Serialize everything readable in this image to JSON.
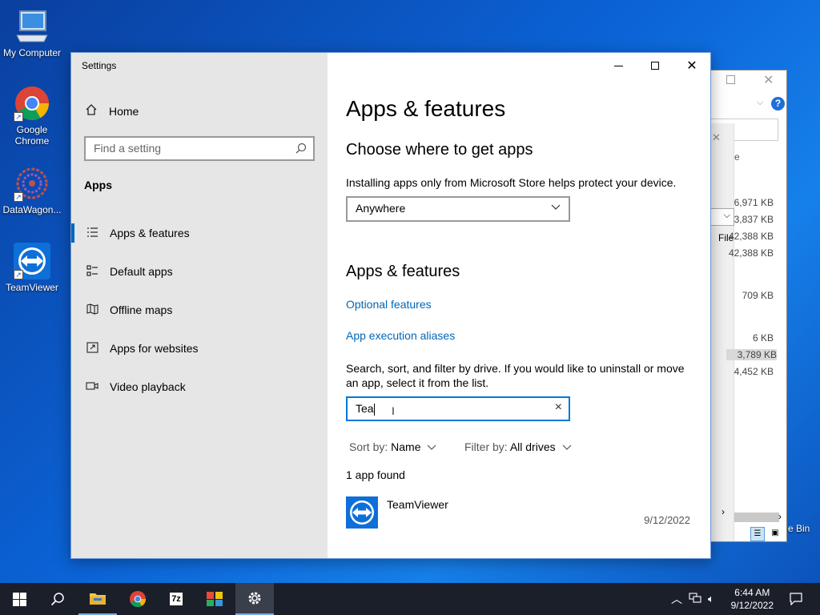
{
  "desktop": {
    "icons": [
      {
        "label": "My Computer",
        "icon": "computer-icon"
      },
      {
        "label": "Google Chrome",
        "icon": "chrome-icon"
      },
      {
        "label": "DataWagon...",
        "icon": "datawagon-icon"
      },
      {
        "label": "TeamViewer",
        "icon": "teamviewer-icon"
      }
    ]
  },
  "background_window": {
    "help_label": "?",
    "partial_text_1": "e",
    "partial_text_2": "File",
    "sizes": [
      "6,971 KB",
      "3,837 KB",
      "42,388 KB",
      "42,388 KB",
      "709 KB",
      "6 KB",
      "3,789 KB",
      "4,452 KB"
    ],
    "recycle_bin": "e Bin"
  },
  "settings": {
    "title": "Settings",
    "sidebar": {
      "home_label": "Home",
      "search_placeholder": "Find a setting",
      "section_label": "Apps",
      "items": [
        {
          "label": "Apps & features",
          "icon": "list-icon",
          "active": true
        },
        {
          "label": "Default apps",
          "icon": "default-apps-icon"
        },
        {
          "label": "Offline maps",
          "icon": "map-icon"
        },
        {
          "label": "Apps for websites",
          "icon": "web-link-icon"
        },
        {
          "label": "Video playback",
          "icon": "video-icon"
        }
      ]
    },
    "main": {
      "page_title": "Apps & features",
      "choose_heading": "Choose where to get apps",
      "choose_desc": "Installing apps only from Microsoft Store helps protect your device.",
      "source_selected": "Anywhere",
      "features_heading": "Apps & features",
      "optional_features_link": "Optional features",
      "aliases_link": "App execution aliases",
      "search_desc": "Search, sort, and filter by drive. If you would like to uninstall or move an app, select it from the list.",
      "search_value": "Tea",
      "sort_label": "Sort by:",
      "sort_value": "Name",
      "filter_label": "Filter by:",
      "filter_value": "All drives",
      "result_count": "1 app found",
      "apps": [
        {
          "name": "TeamViewer",
          "date": "9/12/2022"
        }
      ]
    }
  },
  "taskbar": {
    "clock_time": "6:44 AM",
    "clock_date": "9/12/2022"
  }
}
